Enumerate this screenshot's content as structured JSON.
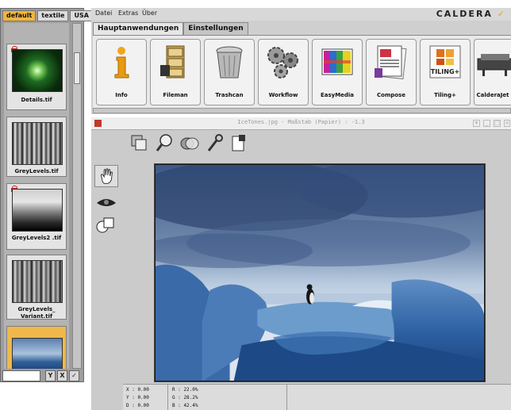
{
  "left_panel": {
    "tabs": [
      "default",
      "textile",
      "USA"
    ],
    "thumbnails": [
      {
        "label": "Details.tif",
        "locked": true
      },
      {
        "label": "GreyLevels.tif",
        "locked": false
      },
      {
        "label": "GreyLevels2 .tif",
        "locked": true
      },
      {
        "label": "GreyLevels_ Variant.tif",
        "locked": false
      },
      {
        "label": "",
        "locked": false,
        "selected": true
      }
    ],
    "filter_placeholder": "",
    "bottom_buttons": [
      "Y",
      "X",
      "✓"
    ]
  },
  "menubar": {
    "items": [
      "Datei",
      "Extras",
      "Über"
    ],
    "logo": "CALDERA"
  },
  "toolbar": {
    "tabs": [
      "Hauptanwendungen",
      "Einstellungen"
    ],
    "apps": [
      {
        "label": "Info",
        "icon": "info-icon"
      },
      {
        "label": "Fileman",
        "icon": "file-cabinet-icon"
      },
      {
        "label": "Trashcan",
        "icon": "trashcan-icon"
      },
      {
        "label": "Workflow",
        "icon": "gears-icon"
      },
      {
        "label": "EasyMedia",
        "icon": "color-chart-icon"
      },
      {
        "label": "Compose",
        "icon": "compose-icon"
      },
      {
        "label": "Tiling+",
        "icon": "tiling-icon"
      },
      {
        "label": "CalderaJet",
        "icon": "printer-icon"
      }
    ]
  },
  "viewer": {
    "title": "IceTones.jpg - Maßstab (Papier) : -1.3",
    "status": {
      "x": "X : 0.00",
      "y": "Y : 0.00",
      "d": "D : 0.00",
      "r": "R : 22.0%",
      "g": "G : 28.2%",
      "b": "B : 42.4%"
    }
  },
  "colors": {
    "accent": "#f0b63c",
    "panel_grey": "#9d9d9d",
    "logo_check": "#e6a020"
  }
}
